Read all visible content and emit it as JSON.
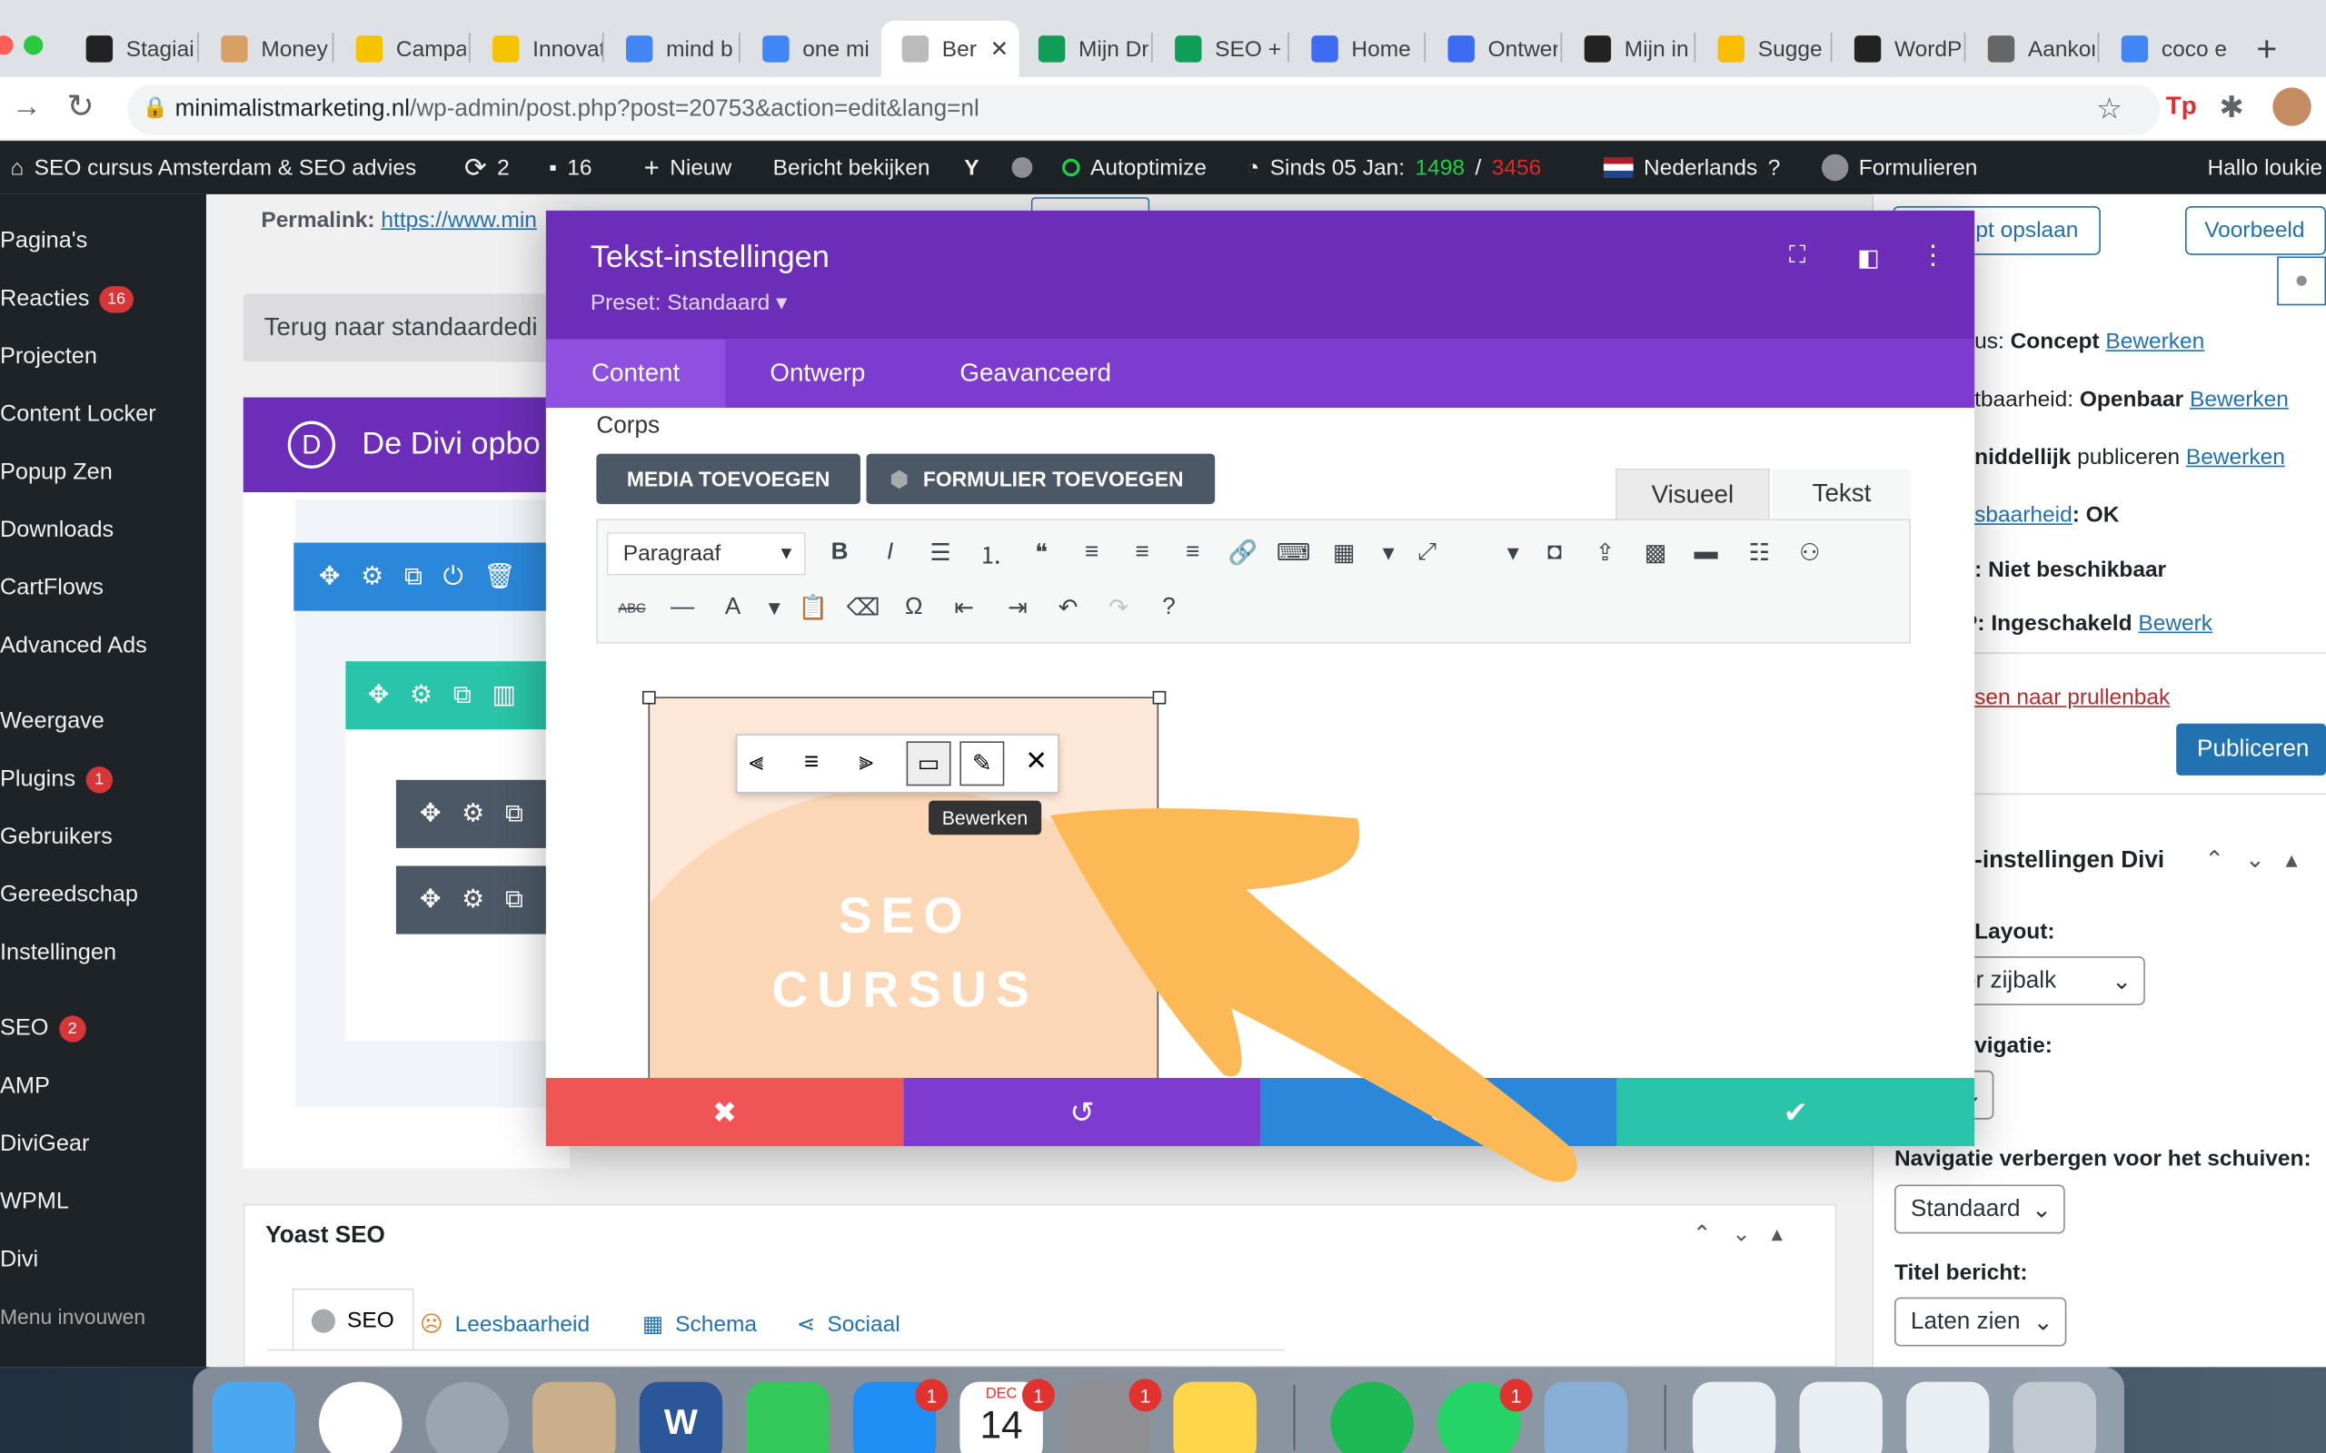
{
  "browser": {
    "tabs": [
      {
        "label": "Stagiai",
        "icon": "notion-icon"
      },
      {
        "label": "Money",
        "icon": "smiley-icon"
      },
      {
        "label": "Campa",
        "icon": "mailchimp-icon"
      },
      {
        "label": "Innovat",
        "icon": "mailchimp-icon"
      },
      {
        "label": "mind b",
        "icon": "google-icon"
      },
      {
        "label": "one mi",
        "icon": "google-icon"
      },
      {
        "label": "Ber",
        "icon": "site-icon",
        "active": true
      },
      {
        "label": "Mijn Dr",
        "icon": "drive-icon"
      },
      {
        "label": "SEO +",
        "icon": "sheets-icon"
      },
      {
        "label": "Home",
        "icon": "canva-icon"
      },
      {
        "label": "Ontwer",
        "icon": "canva-icon"
      },
      {
        "label": "Mijn in",
        "icon": "circle-icon"
      },
      {
        "label": "Sugge",
        "icon": "ads-icon"
      },
      {
        "label": "WordP",
        "icon": "wordpress-icon"
      },
      {
        "label": "Aankor",
        "icon": "shop-icon"
      },
      {
        "label": "coco e",
        "icon": "google-icon"
      }
    ],
    "url_host": "minimalistmarketing.nl",
    "url_path": "/wp-admin/post.php?post=20753&action=edit&lang=nl"
  },
  "adminbar": {
    "site": "SEO cursus Amsterdam & SEO advies",
    "updates": "2",
    "comments": "16",
    "new": "Nieuw",
    "view": "Bericht bekijken",
    "autoptimize": "Autoptimize",
    "since": "Sinds 05 Jan:",
    "count_green": "1498",
    "slash": "/",
    "count_red": "3456",
    "language": "Nederlands",
    "forms": "Formulieren",
    "greeting": "Hallo loukie"
  },
  "sidebar": {
    "items": [
      {
        "label": "Pagina's"
      },
      {
        "label": "Reacties",
        "badge": "16"
      },
      {
        "label": "Projecten"
      },
      {
        "label": "Content Locker"
      },
      {
        "label": "Popup Zen"
      },
      {
        "label": "Downloads"
      },
      {
        "label": "CartFlows"
      },
      {
        "label": "Advanced Ads"
      },
      {
        "label": "Weergave"
      },
      {
        "label": "Plugins",
        "badge": "1"
      },
      {
        "label": "Gebruikers"
      },
      {
        "label": "Gereedschap"
      },
      {
        "label": "Instellingen"
      },
      {
        "label": "SEO",
        "badge": "2"
      },
      {
        "label": "AMP"
      },
      {
        "label": "DiviGear"
      },
      {
        "label": "WPML"
      },
      {
        "label": "Divi"
      },
      {
        "label": "Menu invouwen"
      }
    ]
  },
  "editor": {
    "permalink_label": "Permalink:",
    "permalink_url": "https://www.min",
    "back_button": "Terug naar standaardedi",
    "divi_title": "De Divi opbo"
  },
  "publish_box": {
    "save_draft": "pt opslaan",
    "preview": "Voorbeeld",
    "status_label": "us:",
    "status_value": "Concept",
    "edit": "Bewerken",
    "visibility_label": "tbaarheid:",
    "visibility_value": "Openbaar",
    "edit2": "Bewerken",
    "publish_prefix": "niddellijk",
    "publish_word": "publiceren",
    "edit3": "Bewerken",
    "readability_link": "sbaarheid",
    "readability_value": ": OK",
    "unavailable": ": Niet beschikbaar",
    "p_label": "P:",
    "enabled": "Ingeschakeld",
    "edit4": "Bewerk",
    "trash": "sen naar prullenbak",
    "publish_button": "Publiceren"
  },
  "divi_settings": {
    "title": "-instellingen Divi",
    "layout_label": "Layout:",
    "layout_value": "er zijbalk",
    "nav_label": "vigatie:",
    "hide_nav_label": "Navigatie verbergen voor het schuiven:",
    "hide_nav_value": "Standaard",
    "title_label": "Titel bericht:",
    "title_value": "Laten zien"
  },
  "yoast": {
    "title": "Yoast SEO",
    "tabs": [
      "SEO",
      "Leesbaarheid",
      "Schema",
      "Sociaal"
    ]
  },
  "modal": {
    "title": "Tekst-instellingen",
    "preset": "Preset: Standaard",
    "tabs": [
      "Content",
      "Ontwerp",
      "Geavanceerd"
    ],
    "section_label": "Corps",
    "media_button": "MEDIA TOEVOEGEN",
    "form_button": "FORMULIER TOEVOEGEN",
    "mode_visual": "Visueel",
    "mode_text": "Tekst",
    "format_select": "Paragraaf",
    "image_text_line1": "SEO",
    "image_text_line2": "CURSUS",
    "tooltip": "Bewerken"
  },
  "colors": {
    "purple_dark": "#6c2eb9",
    "purple": "#7e3bd0",
    "red": "#ef5555",
    "blue": "#2b87da",
    "green": "#29c4a9",
    "arrow": "#fdb955",
    "wp_blue": "#2271b1"
  },
  "dock": {
    "badges": [
      "1",
      "1",
      "1",
      "1"
    ],
    "calendar_month": "DEC",
    "calendar_day": "14"
  }
}
